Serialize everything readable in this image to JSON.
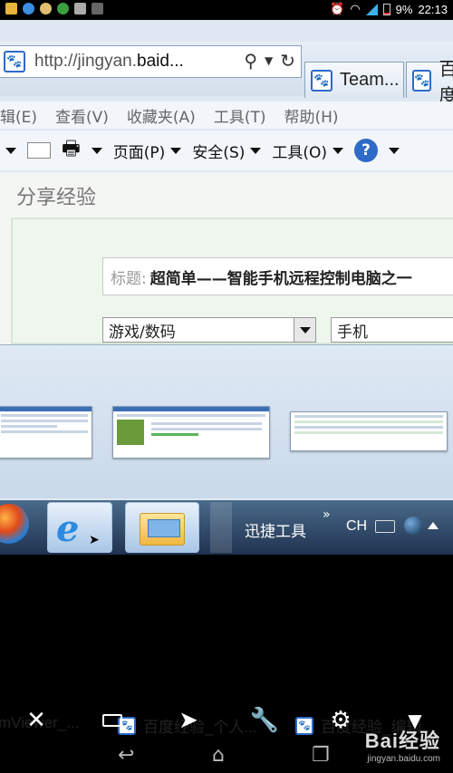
{
  "status_bar": {
    "battery": "9%",
    "time": "22:13"
  },
  "browser": {
    "url_prefix": "http://jingyan.",
    "url_host": "baid...",
    "tabs": [
      {
        "label": "Team..."
      },
      {
        "label": "百度"
      }
    ],
    "menu": [
      "辑(E)",
      "查看(V)",
      "收藏夹(A)",
      "工具(T)",
      "帮助(H)"
    ],
    "command_bar": [
      {
        "label": "页面(P)"
      },
      {
        "label": "安全(S)"
      },
      {
        "label": "工具(O)"
      }
    ]
  },
  "page": {
    "title": "分享经验",
    "title_field_label": "标题:",
    "title_field_value": "超简单——智能手机远程控制电脑之一",
    "category_select": "游戏/数码",
    "subcategory_select": "手机"
  },
  "taskbar_flyout": {
    "items": [
      {
        "label": "mViewer_..."
      },
      {
        "label": "百度经验_个人..."
      },
      {
        "label": "百度经验_编辑..."
      }
    ]
  },
  "taskbar": {
    "toolbar_name": "迅捷工具",
    "lang": "CH"
  },
  "watermark": {
    "brand": "Bai经验",
    "site": "jingyan.baidu.com"
  },
  "colors": {
    "accent": "#2e6ac8",
    "battery_red": "#e03a3a",
    "signal_blue": "#3cb0e8"
  }
}
